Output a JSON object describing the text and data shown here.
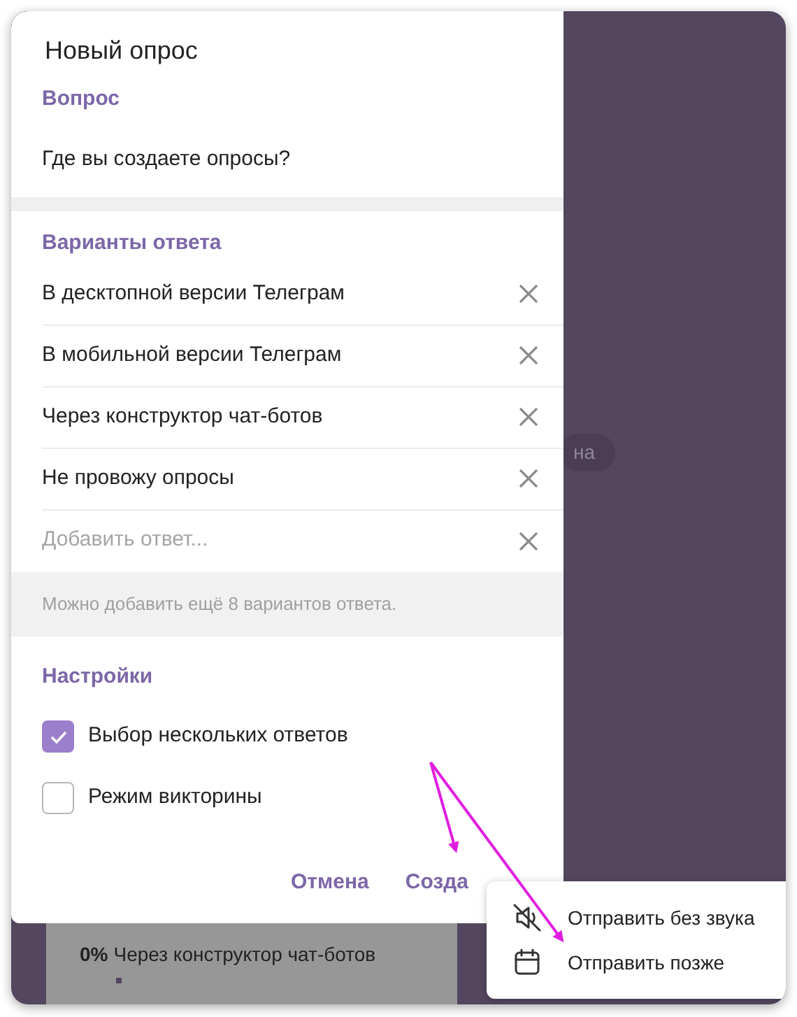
{
  "dialog": {
    "title": "Новый опрос",
    "question_label": "Вопрос",
    "question": "Где вы создаете опросы?",
    "options_label": "Варианты ответа",
    "options": [
      {
        "kind": "answer",
        "text": "В десктопной версии Телеграм"
      },
      {
        "kind": "answer",
        "text": "В мобильной версии Телеграм"
      },
      {
        "kind": "answer",
        "text": "Через конструктор чат-ботов"
      },
      {
        "kind": "answer",
        "text": "Не провожу опросы"
      },
      {
        "kind": "new",
        "placeholder": "Добавить ответ..."
      }
    ],
    "hint": "Можно добавить ещё 8 вариантов ответа.",
    "settings_label": "Настройки",
    "settings": [
      {
        "label": "Выбор нескольких ответов",
        "checked": true
      },
      {
        "label": "Режим викторины",
        "checked": false
      }
    ],
    "buttons": [
      "Отмена",
      "Созда"
    ]
  },
  "background": {
    "chip": "на",
    "poll_row": {
      "percent": "0%",
      "text": "Через конструктор чат-ботов"
    }
  },
  "send_menu": [
    {
      "kind": "mute",
      "label": "Отправить без звука"
    },
    {
      "kind": "schedule",
      "label": "Отправить позже"
    }
  ]
}
